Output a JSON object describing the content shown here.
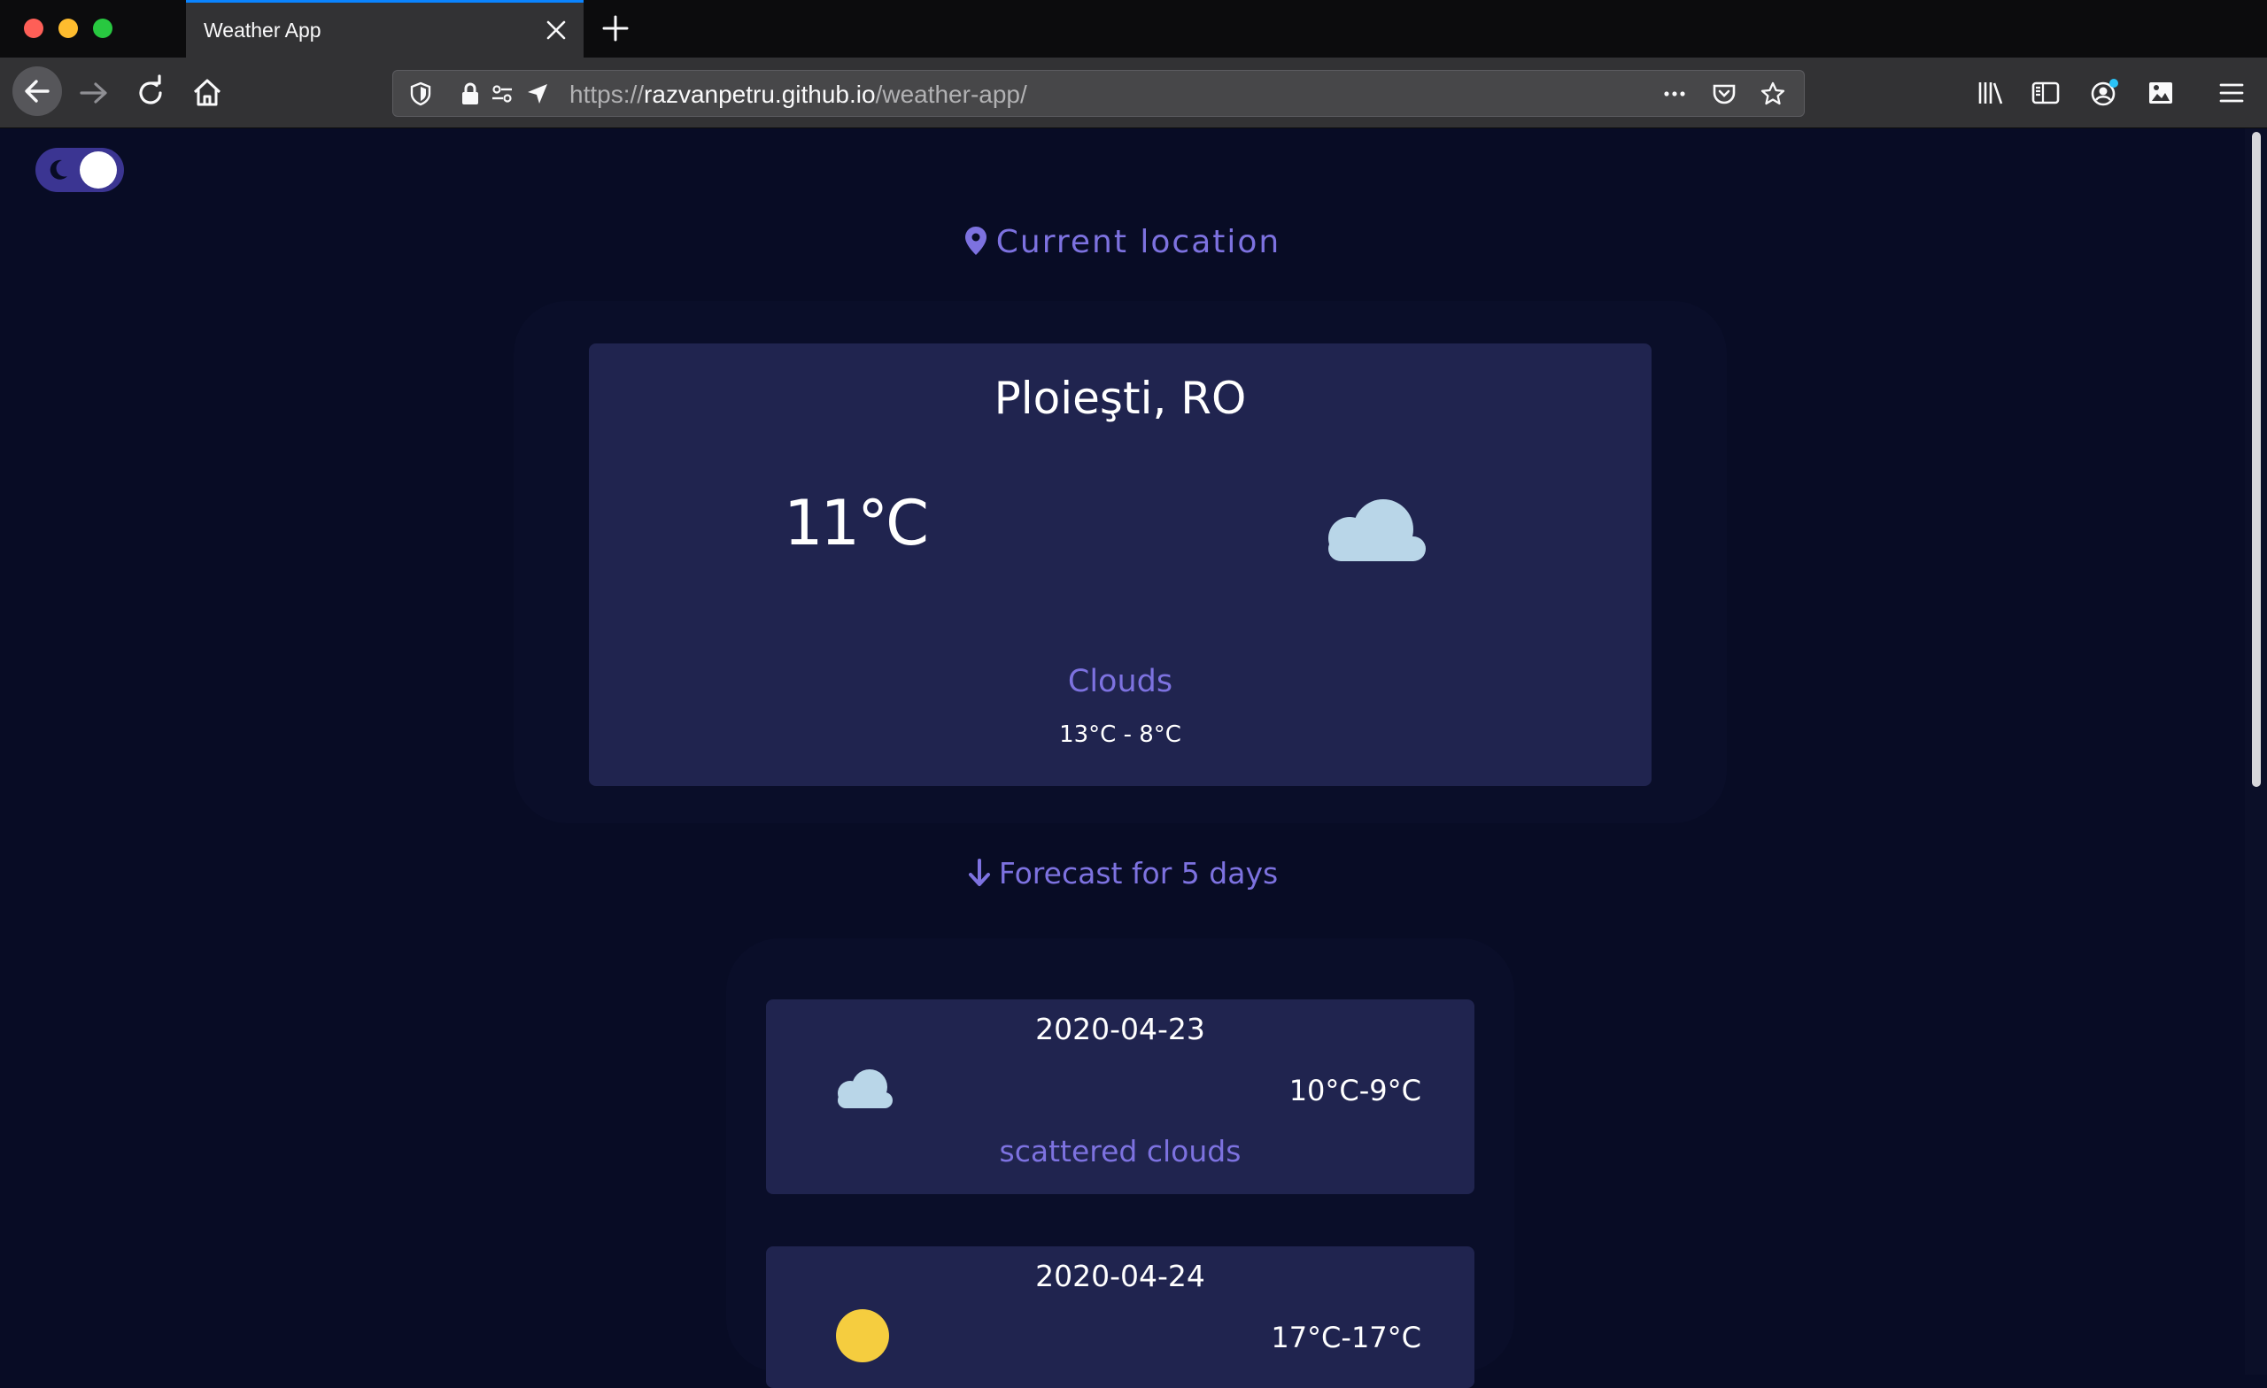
{
  "browser": {
    "tab_title": "Weather App",
    "url_prefix": "https://",
    "url_host": "razvanpetru.github.io",
    "url_path": "/weather-app/"
  },
  "theme_toggle": {
    "mode": "dark",
    "icon": "moon-icon"
  },
  "current_location_label": "Current location",
  "current": {
    "city": "Ploieşti, RO",
    "temperature": "11°C",
    "condition": "Clouds",
    "range": "13°C - 8°C",
    "icon": "cloud-icon"
  },
  "forecast_label": "Forecast for 5 days",
  "forecast": [
    {
      "date": "2020-04-23",
      "temp": "10°C-9°C",
      "description": "scattered clouds",
      "icon": "cloud-icon"
    },
    {
      "date": "2020-04-24",
      "temp": "17°C-17°C",
      "description": "",
      "icon": "sun-icon"
    }
  ],
  "colors": {
    "page_bg": "#080c25",
    "card_bg": "#20244f",
    "accent": "#7d72e0",
    "cloud": "#b9d6e8",
    "sun": "#f5cd3f",
    "toggle_bg": "#3b3592"
  }
}
